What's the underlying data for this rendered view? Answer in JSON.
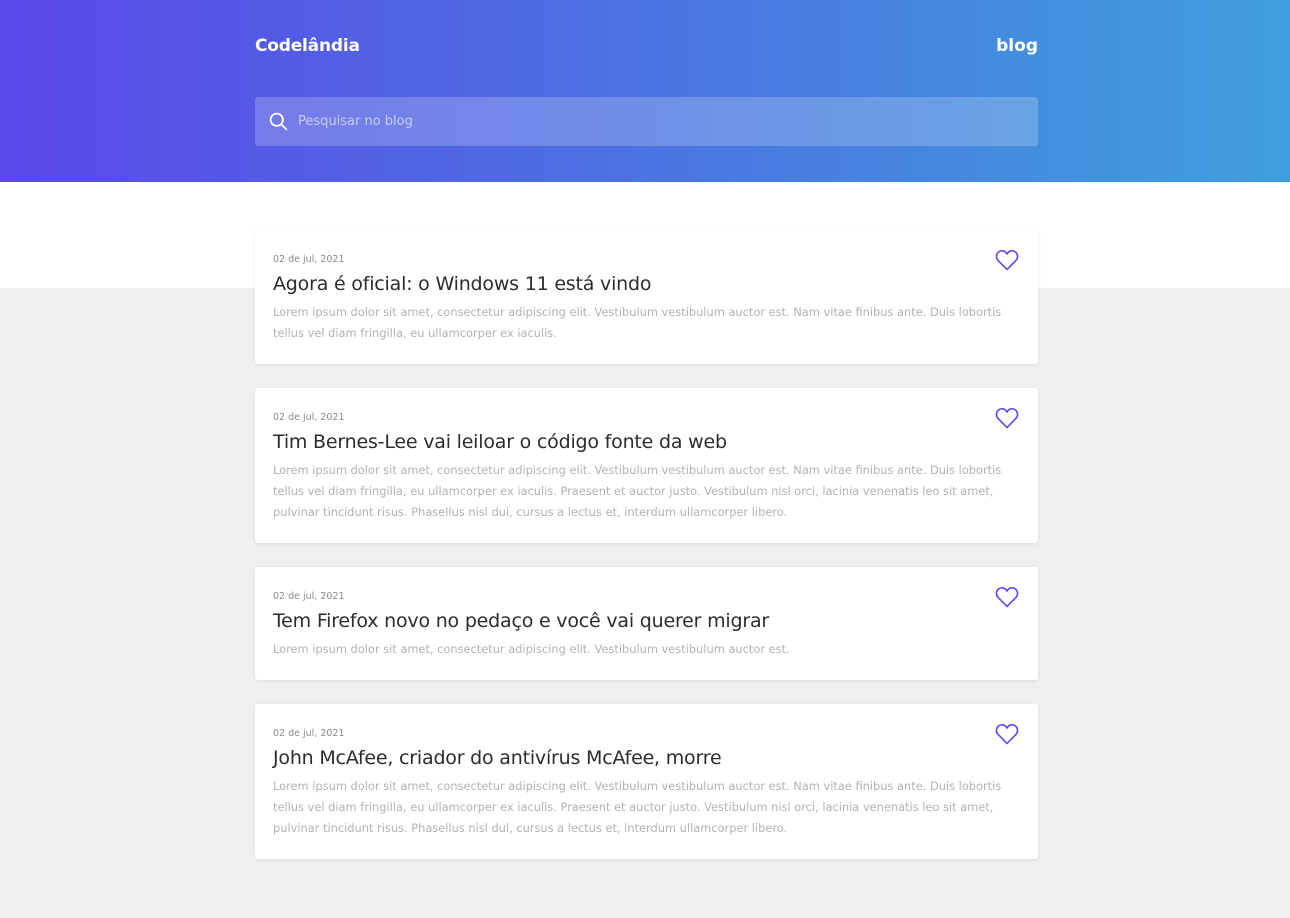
{
  "header": {
    "brand": "Codelândia",
    "nav_label": "blog",
    "search": {
      "placeholder": "Pesquisar no blog",
      "value": ""
    }
  },
  "colors": {
    "accent": "#5a48e8",
    "gradient_start": "#5a48e8",
    "gradient_end": "#3f9fdc"
  },
  "posts": [
    {
      "date": "02 de jul, 2021",
      "title": "Agora é oficial: o Windows 11 está vindo",
      "excerpt": "Lorem ipsum dolor sit amet, consectetur adipiscing elit. Vestibulum vestibulum auctor est. Nam vitae finibus ante. Duis lobortis tellus vel diam fringilla, eu ullamcorper ex iaculis.",
      "icon": "heart-icon"
    },
    {
      "date": "02 de jul, 2021",
      "title": "Tim Bernes-Lee vai leiloar o código fonte da web",
      "excerpt": "Lorem ipsum dolor sit amet, consectetur adipiscing elit. Vestibulum vestibulum auctor est. Nam vitae finibus ante. Duis lobortis tellus vel diam fringilla, eu ullamcorper ex iaculis. Praesent et auctor justo. Vestibulum nisl orci, lacinia venenatis leo sit amet, pulvinar tincidunt risus. Phasellus nisl dui, cursus a lectus et, interdum ullamcorper libero.",
      "icon": "heart-icon"
    },
    {
      "date": "02 de jul, 2021",
      "title": "Tem Firefox novo no pedaço e você vai querer migrar",
      "excerpt": "Lorem ipsum dolor sit amet, consectetur adipiscing elit. Vestibulum vestibulum auctor est.",
      "icon": "heart-icon"
    },
    {
      "date": "02 de jul, 2021",
      "title": "John McAfee, criador do antivírus McAfee, morre",
      "excerpt": "Lorem ipsum dolor sit amet, consectetur adipiscing elit. Vestibulum vestibulum auctor est. Nam vitae finibus ante. Duis lobortis tellus vel diam fringilla, eu ullamcorper ex iaculis. Praesent et auctor justo. Vestibulum nisl orci, lacinia venenatis leo sit amet, pulvinar tincidunt risus. Phasellus nisl dui, cursus a lectus et, interdum ullamcorper libero.",
      "icon": "heart-icon"
    }
  ]
}
